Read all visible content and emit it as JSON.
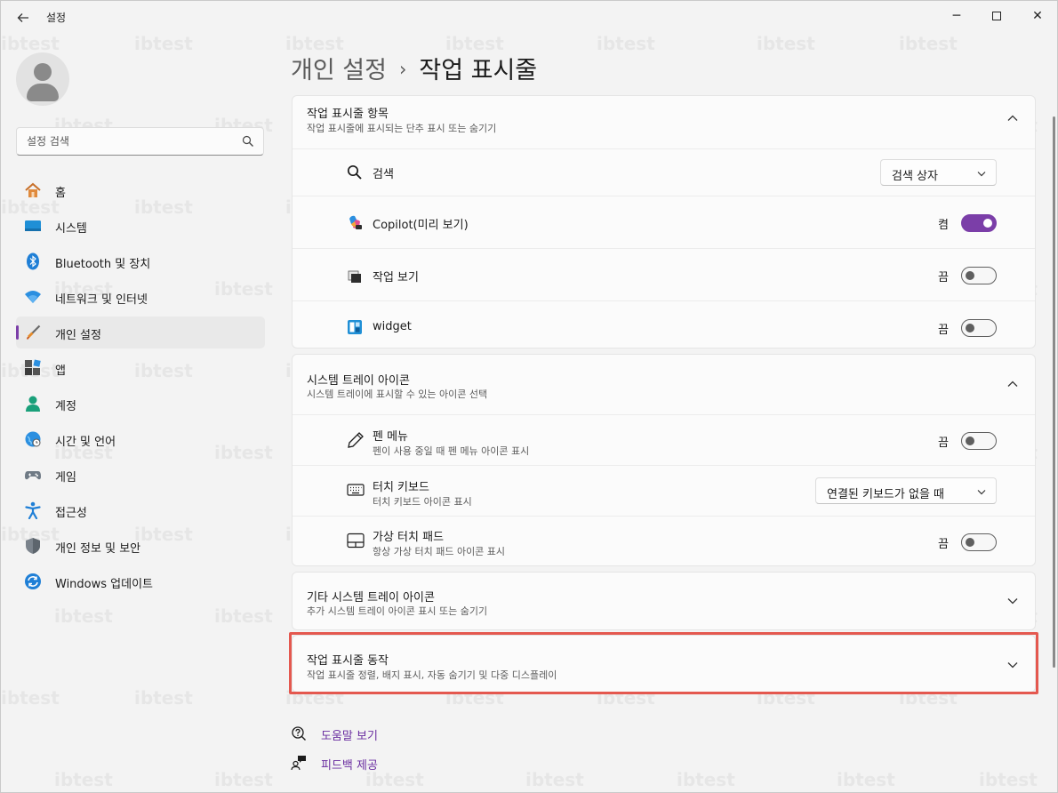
{
  "window": {
    "title": "설정",
    "back_icon": "back-arrow-icon",
    "controls": {
      "minimize": "─",
      "close": "✕"
    }
  },
  "sidebar": {
    "search_placeholder": "설정 검색",
    "items": [
      {
        "label": "홈",
        "icon": "home-icon"
      },
      {
        "label": "시스템",
        "icon": "system-icon"
      },
      {
        "label": "Bluetooth 및 장치",
        "icon": "bluetooth-icon"
      },
      {
        "label": "네트워크 및 인터넷",
        "icon": "wifi-icon"
      },
      {
        "label": "개인 설정",
        "icon": "brush-icon",
        "active": true
      },
      {
        "label": "앱",
        "icon": "apps-icon"
      },
      {
        "label": "계정",
        "icon": "account-icon"
      },
      {
        "label": "시간 및 언어",
        "icon": "clock-globe-icon"
      },
      {
        "label": "게임",
        "icon": "gamepad-icon"
      },
      {
        "label": "접근성",
        "icon": "accessibility-icon"
      },
      {
        "label": "개인 정보 및 보안",
        "icon": "shield-icon"
      },
      {
        "label": "Windows 업데이트",
        "icon": "update-icon"
      }
    ]
  },
  "breadcrumb": {
    "parent": "개인 설정",
    "separator": "›",
    "current": "작업 표시줄"
  },
  "sections": {
    "taskbar_items": {
      "title": "작업 표시줄 항목",
      "subtitle": "작업 표시줄에 표시되는 단추 표시 또는 숨기기",
      "rows": {
        "search": {
          "label": "검색",
          "dropdown": "검색 상자"
        },
        "copilot": {
          "label": "Copilot(미리 보기)",
          "state": "켬",
          "on": true
        },
        "task_view": {
          "label": "작업 보기",
          "state": "끔",
          "on": false
        },
        "widget": {
          "label": "widget",
          "state": "끔",
          "on": false
        }
      }
    },
    "system_tray": {
      "title": "시스템 트레이 아이콘",
      "subtitle": "시스템 트레이에 표시할 수 있는 아이콘 선택",
      "rows": {
        "pen_menu": {
          "label": "펜 메뉴",
          "sub": "펜이 사용 중일 때 펜 메뉴 아이콘 표시",
          "state": "끔",
          "on": false
        },
        "touch_keyboard": {
          "label": "터치 키보드",
          "sub": "터치 키보드 아이콘 표시",
          "dropdown": "연결된 키보드가 없을 때"
        },
        "virtual_touchpad": {
          "label": "가상 터치 패드",
          "sub": "항상 가상 터치 패드 아이콘 표시",
          "state": "끔",
          "on": false
        }
      }
    },
    "other_tray": {
      "title": "기타 시스템 트레이 아이콘",
      "subtitle": "추가 시스템 트레이 아이콘 표시 또는 숨기기"
    },
    "taskbar_behavior": {
      "title": "작업 표시줄 동작",
      "subtitle": "작업 표시줄 정렬, 배지 표시, 자동 숨기기 및 다중 디스플레이"
    }
  },
  "footer_links": {
    "help": "도움말 보기",
    "feedback": "피드백 제공"
  },
  "watermark": "ibtest",
  "colors": {
    "accent": "#7b3ea8",
    "highlight": "#e4584f",
    "link": "#6a2ea0"
  }
}
